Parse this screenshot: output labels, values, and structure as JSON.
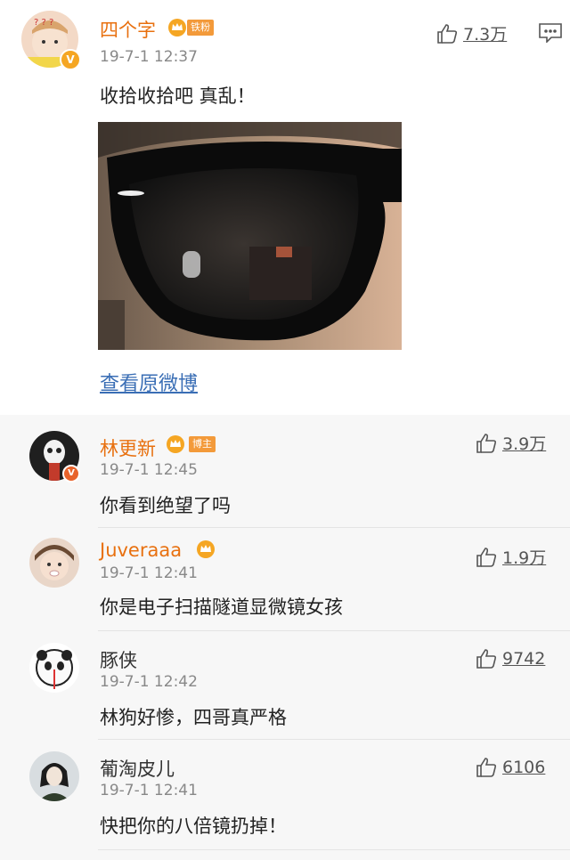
{
  "post": {
    "username": "四个字",
    "badge": "铁粉",
    "time": "19-7-1 12:37",
    "text": "收拾收拾吧 真乱！",
    "likes": "7.3万",
    "view_original": "查看原微博"
  },
  "comments": [
    {
      "username": "林更新",
      "badge": "博主",
      "time": "19-7-1 12:45",
      "text": "你看到绝望了吗",
      "likes": "3.9万"
    },
    {
      "username": "Juveraaa",
      "badge": "",
      "time": "19-7-1 12:41",
      "text": "你是电子扫描隧道显微镜女孩",
      "likes": "1.9万"
    },
    {
      "username": "豚侠",
      "badge": "",
      "time": "19-7-1 12:42",
      "text": "林狗好惨，四哥真严格",
      "likes": "9742"
    },
    {
      "username": "葡淘皮儿",
      "badge": "",
      "time": "19-7-1 12:41",
      "text": "快把你的八倍镜扔掉！",
      "likes": "6106"
    }
  ],
  "colors": {
    "username": "#e8700f",
    "link": "#3a6eb5",
    "verified": "#f5a623"
  },
  "icons": [
    "thumb-up-icon",
    "comment-icon",
    "crown-icon",
    "verified-icon"
  ]
}
